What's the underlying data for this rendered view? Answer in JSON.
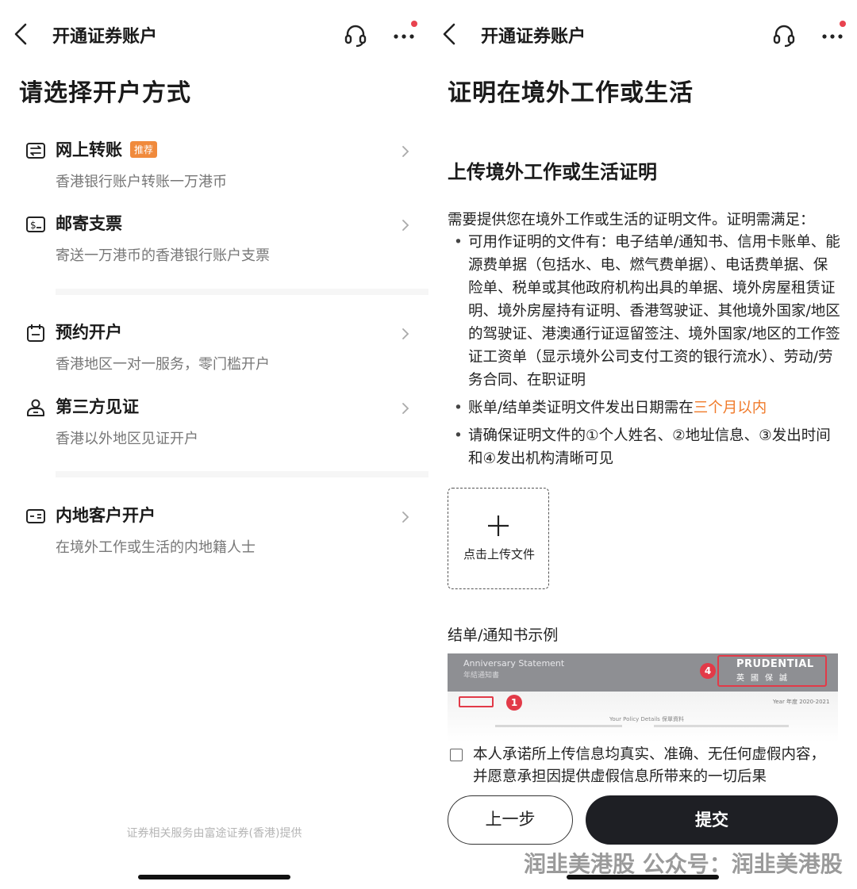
{
  "left": {
    "nav_title": "开通证券账户",
    "page_title": "请选择开户方式",
    "options": [
      {
        "label": "网上转账",
        "badge": "推荐",
        "desc": "香港银行账户转账一万港币",
        "icon": "transfer-icon"
      },
      {
        "label": "邮寄支票",
        "desc": "寄送一万港币的香港银行账户支票",
        "icon": "cheque-icon"
      },
      {
        "label": "预约开户",
        "desc": "香港地区一对一服务，零门槛开户",
        "icon": "calendar-icon"
      },
      {
        "label": "第三方见证",
        "desc": "香港以外地区见证开户",
        "icon": "person-icon"
      },
      {
        "label": "内地客户开户",
        "desc": "在境外工作或生活的内地籍人士",
        "icon": "id-card-icon"
      }
    ],
    "footer_note": "证券相关服务由富途证券(香港)提供"
  },
  "right": {
    "nav_title": "开通证券账户",
    "page_title": "证明在境外工作或生活",
    "section_title": "上传境外工作或生活证明",
    "intro": "需要提供您在境外工作或生活的证明文件。证明需满足：",
    "bullet1": "可用作证明的文件有：电子结单/通知书、信用卡账单、能源费单据（包括水、电、燃气费单据）、电话费单据、保险单、税单或其他政府机构出具的单据、境外房屋租赁证明、境外房屋持有证明、香港驾驶证、其他境外国家/地区的驾驶证、港澳通行证逗留签注、境外国家/地区的工作签证工资单（显示境外公司支付工资的银行流水）、劳动/劳务合同、在职证明",
    "bullet2_prefix": "账单/结单类证明文件发出日期需在",
    "bullet2_highlight": "三个月以内",
    "bullet3": "请确保证明文件的①个人姓名、②地址信息、③发出时间和④发出机构清晰可见",
    "upload_label": "点击上传文件",
    "sample_label": "结单/通知书示例",
    "sample": {
      "title": "Anniversary Statement",
      "title_cn": "年結通知書",
      "logo": "PRUDENTIAL",
      "logo_cn": "英國保誠",
      "marker_1": "1",
      "marker_4": "4",
      "year_text": "Year 年度 2020-2021",
      "policy_text": "Your Policy Details 保單資料"
    },
    "agreement": "本人承诺所上传信息均真实、准确、无任何虚假内容，并愿意承担因提供虚假信息所带来的一切后果",
    "prev_button": "上一步",
    "submit_button": "提交",
    "watermark": "润韭美港股 公众号：润韭美港股"
  },
  "colors": {
    "accent_orange": "#f07a2a",
    "badge_orange": "#f08a3c",
    "submit_dark": "#1e1f24",
    "notification_red": "#e8434f"
  }
}
